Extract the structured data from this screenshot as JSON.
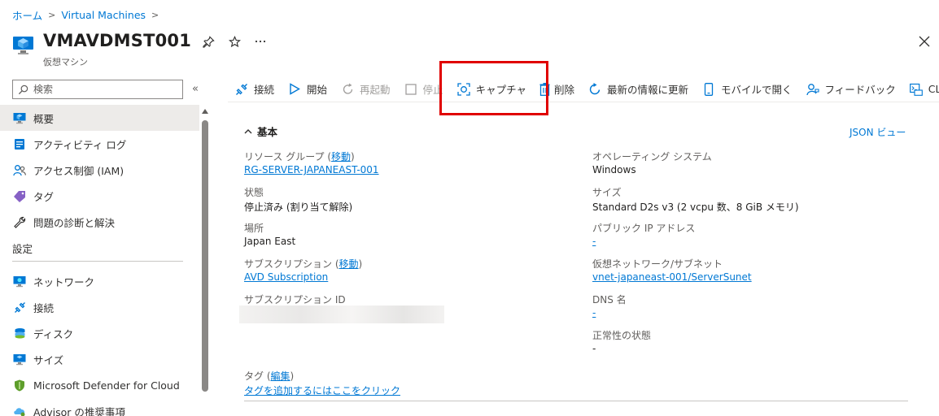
{
  "breadcrumb": {
    "home": "ホーム",
    "vms": "Virtual Machines"
  },
  "header": {
    "title": "VMAVDMST001",
    "subtitle": "仮想マシン"
  },
  "search": {
    "placeholder": "検索"
  },
  "sidebar": {
    "items": [
      {
        "label": "概要",
        "icon": "monitor-icon"
      },
      {
        "label": "アクティビティ ログ",
        "icon": "activity-log-icon"
      },
      {
        "label": "アクセス制御 (IAM)",
        "icon": "people-icon"
      },
      {
        "label": "タグ",
        "icon": "tag-icon"
      },
      {
        "label": "問題の診断と解決",
        "icon": "wrench-icon"
      }
    ],
    "section": "設定",
    "settings_items": [
      {
        "label": "ネットワーク",
        "icon": "network-icon"
      },
      {
        "label": "接続",
        "icon": "connect-icon"
      },
      {
        "label": "ディスク",
        "icon": "disk-icon"
      },
      {
        "label": "サイズ",
        "icon": "size-icon"
      },
      {
        "label": "Microsoft Defender for Cloud",
        "icon": "shield-icon"
      },
      {
        "label": "Advisor の推奨事項",
        "icon": "advisor-icon"
      }
    ]
  },
  "toolbar": {
    "connect": "接続",
    "start": "開始",
    "restart": "再起動",
    "stop": "停止",
    "capture": "キャプチャ",
    "delete": "削除",
    "refresh": "最新の情報に更新",
    "mobile": "モバイルで開く",
    "feedback": "フィードバック",
    "cli": "CLI / PS"
  },
  "essentials": {
    "header": "基本",
    "json_view": "JSON ビュー",
    "move": "移動",
    "edit": "編集",
    "resource_group_label": "リソース グループ",
    "resource_group_value": "RG-SERVER-JAPANEAST-001",
    "status_label": "状態",
    "status_value": "停止済み (割り当て解除)",
    "location_label": "場所",
    "location_value": "Japan East",
    "subscription_label": "サブスクリプション",
    "subscription_value": "AVD Subscription",
    "subscription_id_label": "サブスクリプション ID",
    "os_label": "オペレーティング システム",
    "os_value": "Windows",
    "size_label": "サイズ",
    "size_value": "Standard D2s v3 (2 vcpu 数、8 GiB メモリ)",
    "public_ip_label": "パブリック IP アドレス",
    "public_ip_value": "-",
    "vnet_label": "仮想ネットワーク/サブネット",
    "vnet_value": "vnet-japaneast-001/ServerSunet",
    "dns_label": "DNS 名",
    "dns_value": "-",
    "health_label": "正常性の状態",
    "health_value": "-",
    "tags_label": "タグ",
    "tags_add": "タグを追加するにはここをクリック"
  },
  "colors": {
    "link": "#0078d4",
    "highlight": "#e00000"
  }
}
